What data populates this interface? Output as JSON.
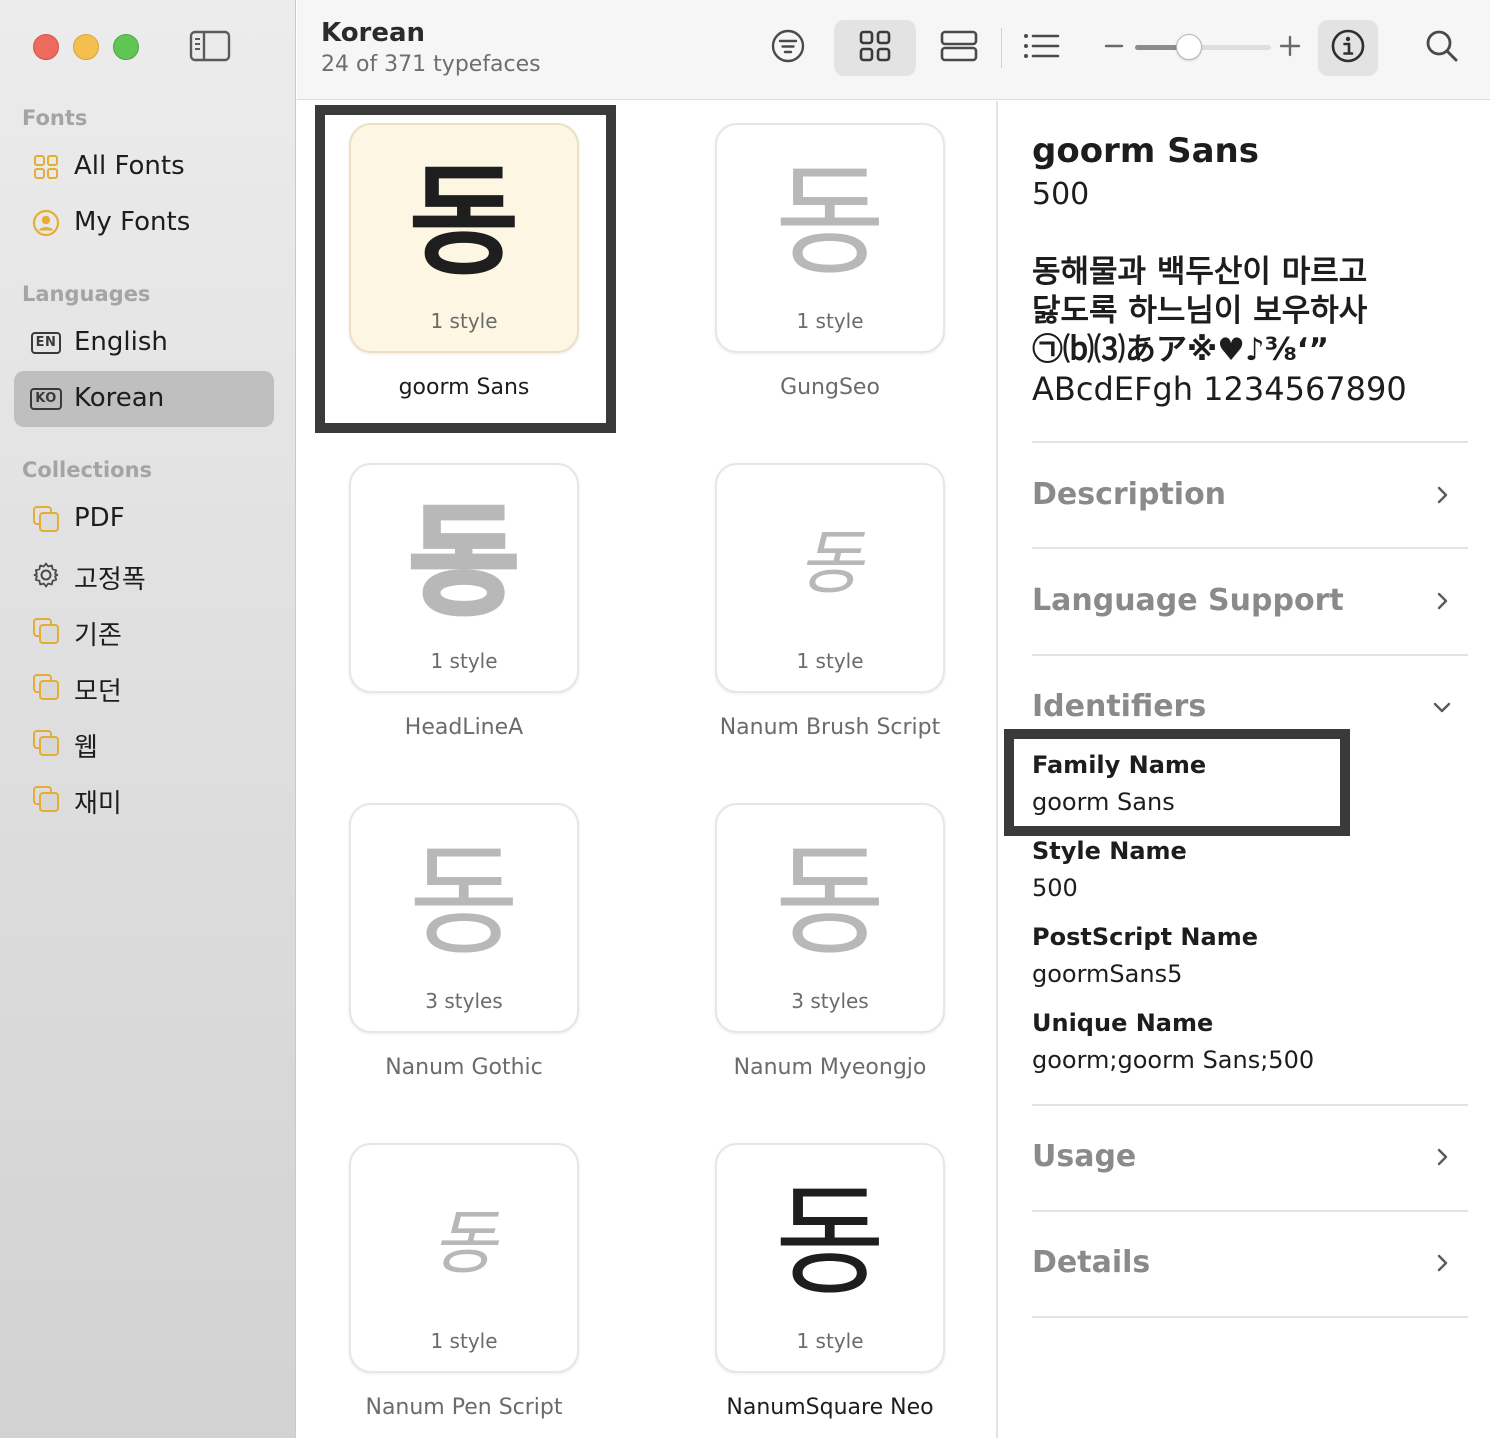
{
  "sidebar": {
    "sections": {
      "fonts": "Fonts",
      "languages": "Languages",
      "collections": "Collections"
    },
    "fonts_items": [
      {
        "label": "All Fonts",
        "icon": "grid-icon"
      },
      {
        "label": "My Fonts",
        "icon": "person-circle-icon"
      }
    ],
    "language_items": [
      {
        "label": "English",
        "badge": "EN",
        "selected": false
      },
      {
        "label": "Korean",
        "badge": "KO",
        "selected": true
      }
    ],
    "collection_items": [
      {
        "label": "PDF",
        "icon": "collection-icon"
      },
      {
        "label": "고정폭",
        "icon": "gear-icon"
      },
      {
        "label": "기존",
        "icon": "collection-icon"
      },
      {
        "label": "모던",
        "icon": "collection-icon"
      },
      {
        "label": "웹",
        "icon": "collection-icon"
      },
      {
        "label": "재미",
        "icon": "collection-icon"
      }
    ]
  },
  "toolbar": {
    "title": "Korean",
    "subtitle": "24 of 371 typefaces",
    "view_mode": "grid",
    "zoom_level": 0.4
  },
  "grid": {
    "tiles": [
      {
        "glyph": "동",
        "styles": "1 style",
        "name": "goorm Sans",
        "selected": true
      },
      {
        "glyph": "동",
        "styles": "1 style",
        "name": "GungSeo",
        "selected": false
      },
      {
        "glyph": "동",
        "styles": "1 style",
        "name": "HeadLineA",
        "selected": false
      },
      {
        "glyph": "동",
        "styles": "1 style",
        "name": "Nanum Brush Script",
        "selected": false
      },
      {
        "glyph": "동",
        "styles": "3 styles",
        "name": "Nanum Gothic",
        "selected": false
      },
      {
        "glyph": "동",
        "styles": "3 styles",
        "name": "Nanum Myeongjo",
        "selected": false
      },
      {
        "glyph": "동",
        "styles": "1 style",
        "name": "Nanum Pen Script",
        "selected": false
      },
      {
        "glyph": "동",
        "styles": "1 style",
        "name": "NanumSquare Neo",
        "selected": false
      }
    ]
  },
  "detail": {
    "title": "goorm Sans",
    "weight": "500",
    "sample_lines": [
      "동해물과 백두산이 마르고",
      "닳도록 하느님이 보우하사",
      "㉠⒝⑶あア※♥♪⅜‘”",
      "ABcdEFgh 1234567890"
    ],
    "sections": {
      "description": "Description",
      "language_support": "Language Support",
      "identifiers": "Identifiers",
      "usage": "Usage",
      "details": "Details"
    },
    "identifiers": {
      "family_name_label": "Family Name",
      "family_name": "goorm Sans",
      "style_name_label": "Style Name",
      "style_name": "500",
      "postscript_name_label": "PostScript Name",
      "postscript_name": "goormSans5",
      "unique_name_label": "Unique Name",
      "unique_name": "goorm;goorm Sans;500"
    }
  },
  "colors": {
    "accent_yellow": "#f5bf4f",
    "selected_card": "#fdf6e2",
    "focus_outline": "#3a3a3a"
  }
}
